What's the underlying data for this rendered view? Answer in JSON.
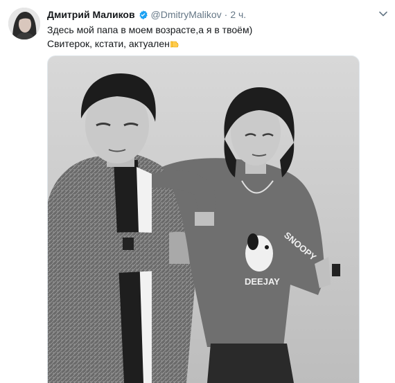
{
  "tweet": {
    "author_name": "Дмитрий Маликов",
    "author_handle": "@DmitryMalikov",
    "separator": "·",
    "time": "2 ч.",
    "text_line1": "Здесь мой папа в моем возрасте,а я в твоём)",
    "text_line2": "Свитерок, кстати, актуален",
    "emoji": "pointing-hand-emoji",
    "media": {
      "sweatshirt_print_top": "SNOOPY",
      "sweatshirt_print_bottom": "DEEJAY"
    }
  },
  "colors": {
    "text": "#14171a",
    "secondary_text": "#657786",
    "verified_badge": "#1da1f2",
    "border": "#e1e8ed",
    "emoji": "#ffcc4d"
  },
  "icons": [
    "avatar",
    "verified-badge-icon",
    "chevron-down-icon",
    "pointing-hand-emoji"
  ]
}
